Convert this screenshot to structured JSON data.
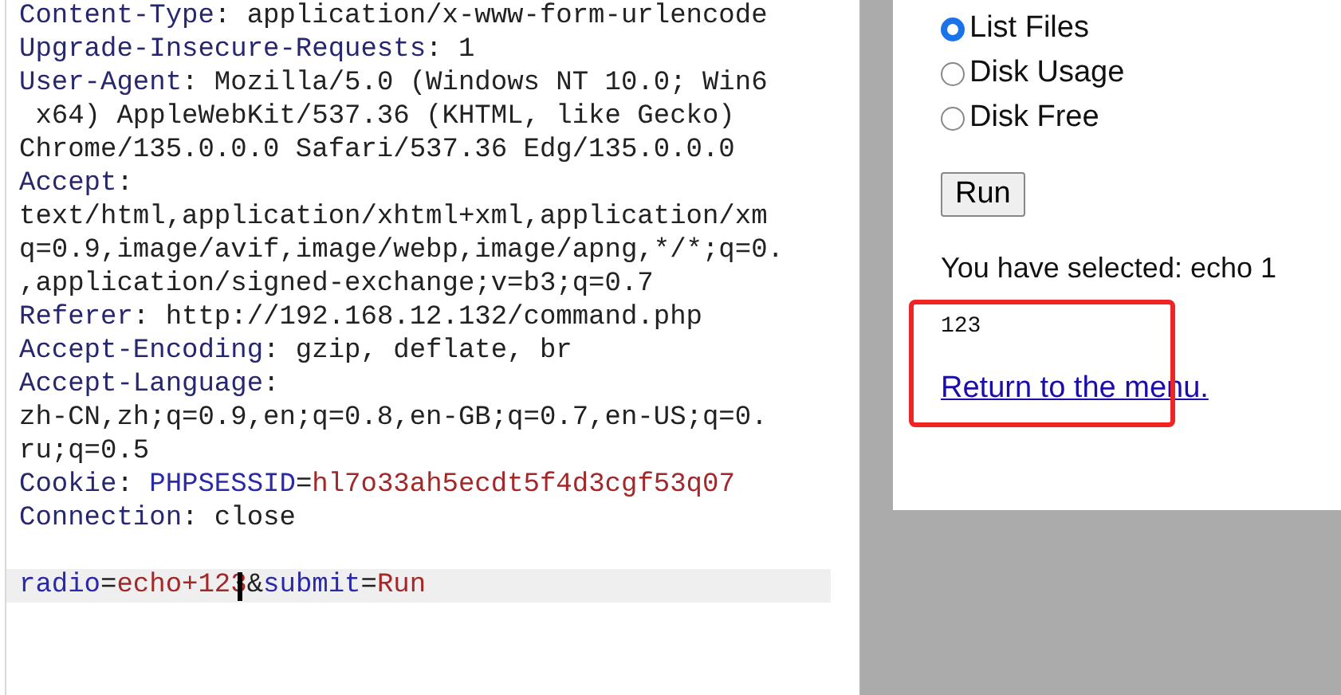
{
  "request_editor": {
    "lines": [
      {
        "current": false,
        "segments": [
          {
            "kind": "key",
            "text": "Content-Type"
          },
          {
            "kind": "text",
            "text": ": application/x-www-form-urlencode"
          }
        ]
      },
      {
        "current": false,
        "segments": [
          {
            "kind": "key",
            "text": "Upgrade-Insecure-Requests"
          },
          {
            "kind": "text",
            "text": ": 1"
          }
        ]
      },
      {
        "current": false,
        "segments": [
          {
            "kind": "key",
            "text": "User-Agent"
          },
          {
            "kind": "text",
            "text": ": Mozilla/5.0 (Windows NT 10.0; Win6"
          }
        ]
      },
      {
        "current": false,
        "segments": [
          {
            "kind": "text",
            "text": " x64) AppleWebKit/537.36 (KHTML, like Gecko)"
          }
        ]
      },
      {
        "current": false,
        "segments": [
          {
            "kind": "text",
            "text": "Chrome/135.0.0.0 Safari/537.36 Edg/135.0.0.0"
          }
        ]
      },
      {
        "current": false,
        "segments": [
          {
            "kind": "key",
            "text": "Accept"
          },
          {
            "kind": "text",
            "text": ":"
          }
        ]
      },
      {
        "current": false,
        "segments": [
          {
            "kind": "text",
            "text": "text/html,application/xhtml+xml,application/xm"
          }
        ]
      },
      {
        "current": false,
        "segments": [
          {
            "kind": "text",
            "text": "q=0.9,image/avif,image/webp,image/apng,*/*;q=0."
          }
        ]
      },
      {
        "current": false,
        "segments": [
          {
            "kind": "text",
            "text": ",application/signed-exchange;v=b3;q=0.7"
          }
        ]
      },
      {
        "current": false,
        "segments": [
          {
            "kind": "key",
            "text": "Referer"
          },
          {
            "kind": "text",
            "text": ": http://192.168.12.132/command.php"
          }
        ]
      },
      {
        "current": false,
        "segments": [
          {
            "kind": "key",
            "text": "Accept-Encoding"
          },
          {
            "kind": "text",
            "text": ": gzip, deflate, br"
          }
        ]
      },
      {
        "current": false,
        "segments": [
          {
            "kind": "key",
            "text": "Accept-Language"
          },
          {
            "kind": "text",
            "text": ":"
          }
        ]
      },
      {
        "current": false,
        "segments": [
          {
            "kind": "text",
            "text": "zh-CN,zh;q=0.9,en;q=0.8,en-GB;q=0.7,en-US;q=0."
          }
        ]
      },
      {
        "current": false,
        "segments": [
          {
            "kind": "text",
            "text": "ru;q=0.5"
          }
        ]
      },
      {
        "current": false,
        "segments": [
          {
            "kind": "key",
            "text": "Cookie"
          },
          {
            "kind": "text",
            "text": ": "
          },
          {
            "kind": "name",
            "text": "PHPSESSID"
          },
          {
            "kind": "text",
            "text": "="
          },
          {
            "kind": "value",
            "text": "hl7o33ah5ecdt5f4d3cgf53q07"
          }
        ]
      },
      {
        "current": false,
        "segments": [
          {
            "kind": "key",
            "text": "Connection"
          },
          {
            "kind": "text",
            "text": ": close"
          }
        ]
      },
      {
        "current": false
      },
      {
        "current": true,
        "segments": [
          {
            "kind": "name",
            "text": "radio"
          },
          {
            "kind": "text",
            "text": "="
          },
          {
            "kind": "value",
            "text": "echo+123",
            "caret": true
          },
          {
            "kind": "text",
            "text": "&"
          },
          {
            "kind": "name",
            "text": "submit"
          },
          {
            "kind": "text",
            "text": "="
          },
          {
            "kind": "value",
            "text": "Run"
          }
        ]
      }
    ]
  },
  "page": {
    "options": [
      {
        "label": "List Files",
        "selected": true
      },
      {
        "label": "Disk Usage",
        "selected": false
      },
      {
        "label": "Disk Free",
        "selected": false
      }
    ],
    "button": "Run",
    "selection": "You have selected: echo 1",
    "output": "123",
    "link": "Return to the menu."
  }
}
